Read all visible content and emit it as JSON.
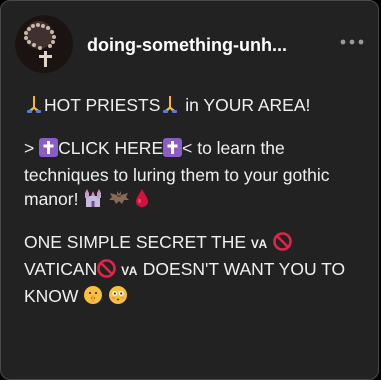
{
  "post": {
    "author": "doing-something-unh...",
    "paragraphs": {
      "p1": {
        "text1": "HOT PRIESTS",
        "text2": " in YOUR AREA!"
      },
      "p2": {
        "text1": "> ",
        "text2": "CLICK HERE",
        "text3": "< to learn the techniques to luring them to your gothic manor!"
      },
      "p3": {
        "text1": "ONE SIMPLE SECRET THE ",
        "va1": "VA",
        "text2": "VATICAN",
        "va2": "VA",
        "text3": " DOESN'T WANT YOU TO KNOW "
      }
    }
  },
  "icons": {
    "more": "more-horizontal-icon",
    "praying_hands": "praying-hands-icon",
    "cross": "latin-cross-icon",
    "castle": "castle-icon",
    "bat": "bat-icon",
    "blood_drop": "blood-drop-icon",
    "prohibited": "prohibited-icon",
    "shushing_face": "shushing-face-icon",
    "flushed_face": "flushed-face-icon"
  },
  "colors": {
    "card_bg": "#222222",
    "text": "#f0f0f0",
    "cross_bg": "#8a5ec7",
    "prohibited": "#e0244a",
    "drop": "#d4113a"
  }
}
